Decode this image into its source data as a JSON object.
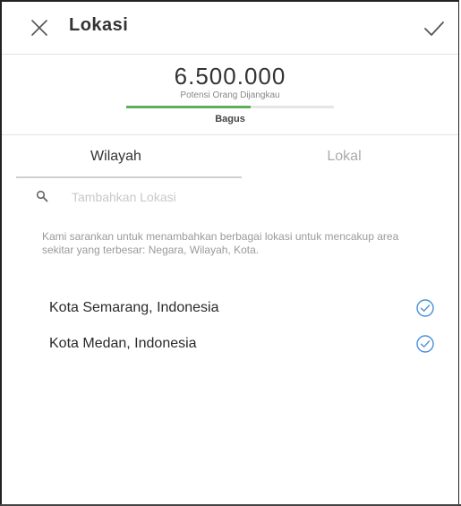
{
  "header": {
    "title": "Lokasi"
  },
  "reach": {
    "value": "6.500.000",
    "label": "Potensi Orang Dijangkau",
    "quality": "Bagus",
    "quality_fraction": 0.6,
    "accent_color": "#5fae5a"
  },
  "tabs": [
    {
      "label": "Wilayah",
      "active": true
    },
    {
      "label": "Lokal",
      "active": false
    }
  ],
  "search": {
    "placeholder": "Tambahkan Lokasi",
    "value": ""
  },
  "hint": "Kami sarankan untuk menambahkan berbagai lokasi untuk mencakup area sekitar yang terbesar: Negara, Wilayah, Kota.",
  "locations": [
    {
      "label": "Kota Semarang, Indonesia",
      "selected": true
    },
    {
      "label": "Kota Medan, Indonesia",
      "selected": true
    }
  ],
  "colors": {
    "check_blue": "#4a90d9",
    "text_muted": "#9a9a9a"
  }
}
